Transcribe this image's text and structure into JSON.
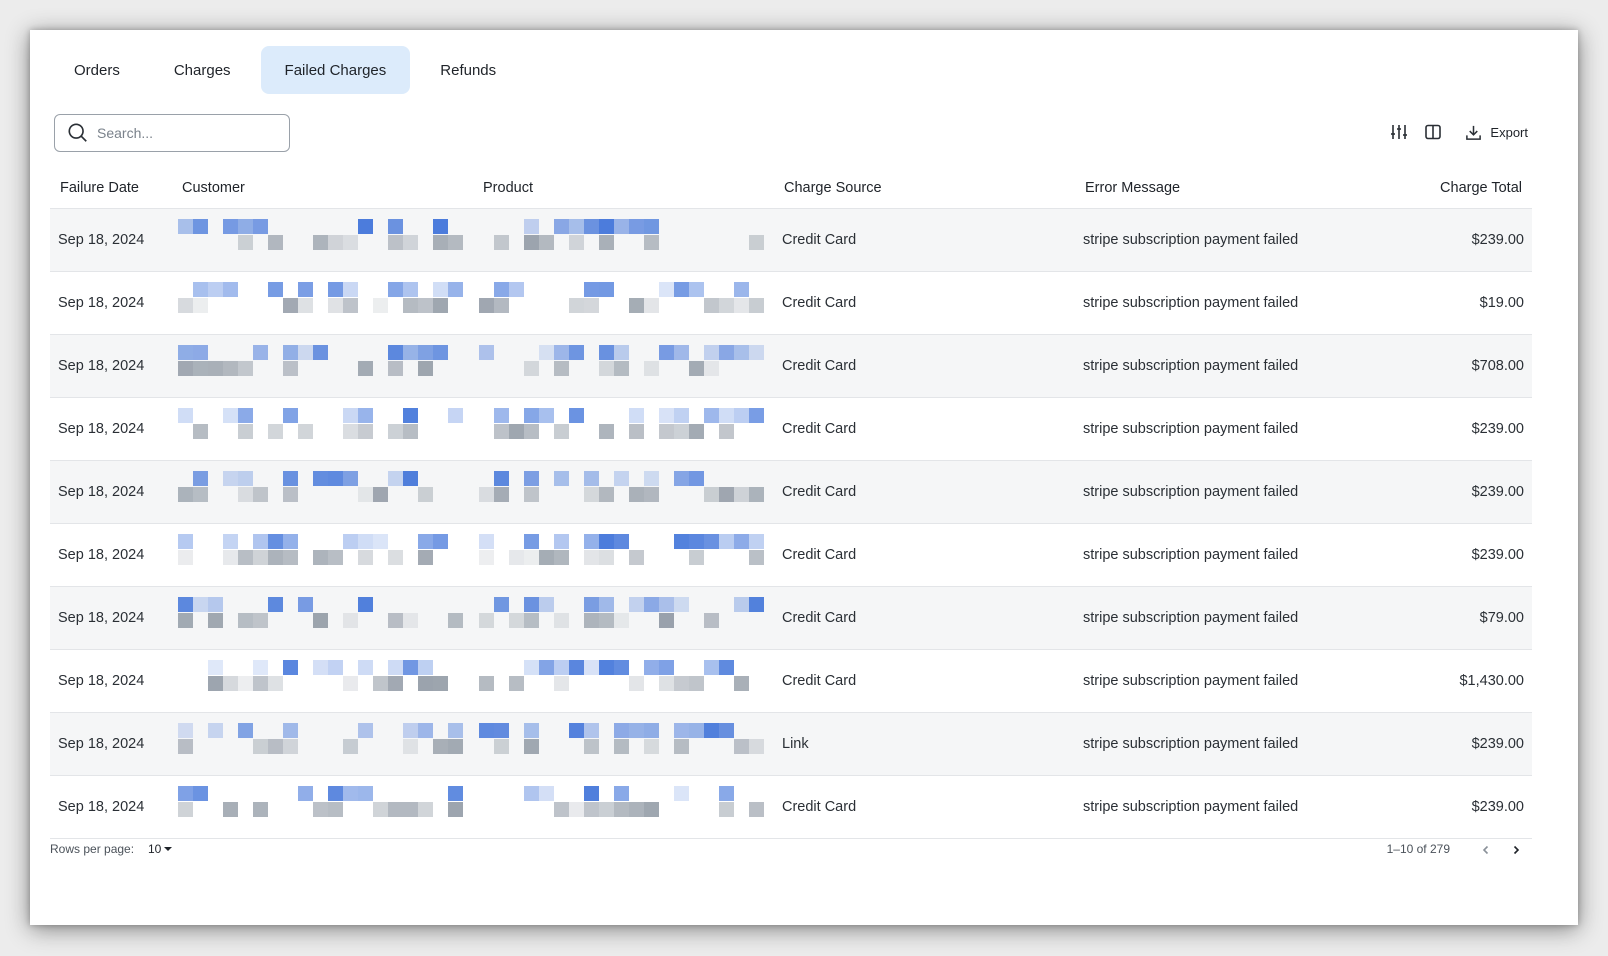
{
  "tabs": [
    {
      "label": "Orders"
    },
    {
      "label": "Charges"
    },
    {
      "label": "Failed Charges",
      "active": true
    },
    {
      "label": "Refunds"
    }
  ],
  "search": {
    "placeholder": "Search..."
  },
  "toolbar": {
    "export_label": "Export"
  },
  "table": {
    "headers": {
      "date": "Failure Date",
      "customer": "Customer",
      "product": "Product",
      "source": "Charge Source",
      "error": "Error Message",
      "total": "Charge Total"
    },
    "rows": [
      {
        "date": "Sep 18, 2024",
        "source": "Credit Card",
        "error": "stripe subscription payment failed",
        "total": "$239.00"
      },
      {
        "date": "Sep 18, 2024",
        "source": "Credit Card",
        "error": "stripe subscription payment failed",
        "total": "$19.00"
      },
      {
        "date": "Sep 18, 2024",
        "source": "Credit Card",
        "error": "stripe subscription payment failed",
        "total": "$708.00"
      },
      {
        "date": "Sep 18, 2024",
        "source": "Credit Card",
        "error": "stripe subscription payment failed",
        "total": "$239.00"
      },
      {
        "date": "Sep 18, 2024",
        "source": "Credit Card",
        "error": "stripe subscription payment failed",
        "total": "$239.00"
      },
      {
        "date": "Sep 18, 2024",
        "source": "Credit Card",
        "error": "stripe subscription payment failed",
        "total": "$239.00"
      },
      {
        "date": "Sep 18, 2024",
        "source": "Credit Card",
        "error": "stripe subscription payment failed",
        "total": "$79.00"
      },
      {
        "date": "Sep 18, 2024",
        "source": "Credit Card",
        "error": "stripe subscription payment failed",
        "total": "$1,430.00"
      },
      {
        "date": "Sep 18, 2024",
        "source": "Link",
        "error": "stripe subscription payment failed",
        "total": "$239.00"
      },
      {
        "date": "Sep 18, 2024",
        "source": "Credit Card",
        "error": "stripe subscription payment failed",
        "total": "$239.00"
      }
    ]
  },
  "footer": {
    "rows_per_page_label": "Rows per page:",
    "rows_per_page_value": "10",
    "page_info": "1–10 of 279"
  },
  "colors": {
    "active_tab_bg": "#dcebfb",
    "redact_blue": "#3a6fd8",
    "redact_gray": "#8f98a3"
  }
}
